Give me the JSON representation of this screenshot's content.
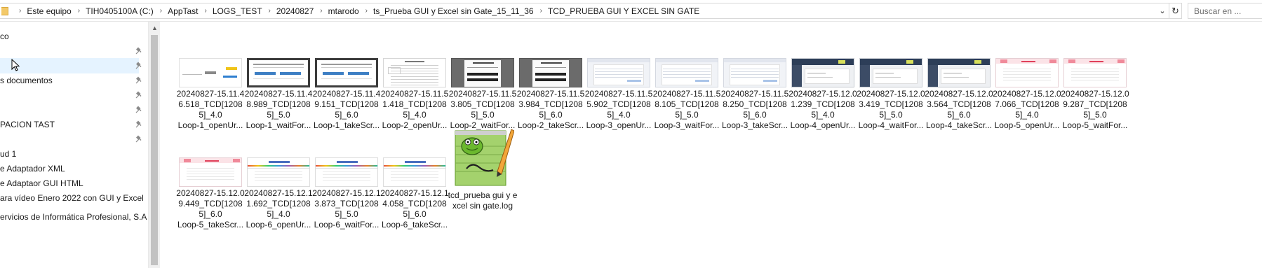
{
  "breadcrumb": [
    "Este equipo",
    "TIH0405100A (C:)",
    "AppTast",
    "LOGS_TEST",
    "20240827",
    "mtarodo",
    "ts_Prueba GUI y Excel sin Gate_15_11_36",
    "TCD_PRUEBA GUI Y EXCEL SIN GATE"
  ],
  "search": {
    "placeholder": "Buscar en ..."
  },
  "nav": {
    "items": [
      {
        "label": "co",
        "pinned": false,
        "selected": false
      },
      {
        "label": "",
        "pinned": true,
        "selected": false
      },
      {
        "label": "",
        "pinned": true,
        "selected": true
      },
      {
        "label": "s documentos",
        "pinned": true,
        "selected": false
      },
      {
        "label": "",
        "pinned": true,
        "selected": false
      },
      {
        "label": "",
        "pinned": true,
        "selected": false
      },
      {
        "label": "PACION TAST",
        "pinned": true,
        "selected": false
      },
      {
        "label": "",
        "pinned": true,
        "selected": false
      },
      {
        "label": "ud 1",
        "pinned": false,
        "selected": false
      },
      {
        "label": "e Adaptador XML",
        "pinned": false,
        "selected": false
      },
      {
        "label": "e Adaptaor GUI HTML",
        "pinned": false,
        "selected": false
      },
      {
        "label": "ara vídeo Enero 2022 con GUI y Excel",
        "pinned": false,
        "selected": false
      },
      {
        "label": "ervicios de Informática Profesional, S.A",
        "pinned": false,
        "selected": false
      }
    ]
  },
  "files": [
    {
      "label": "20240827-15.11.46.518_TCD[12085]_4.0\nLoop-1_openUr...",
      "thumb": "white"
    },
    {
      "label": "20240827-15.11.48.989_TCD[12085]_5.0\nLoop-1_waitFor...",
      "thumb": "dark"
    },
    {
      "label": "20240827-15.11.49.151_TCD[12085]_6.0\nLoop-1_takeScr...",
      "thumb": "dark"
    },
    {
      "label": "20240827-15.11.51.418_TCD[12085]_4.0\nLoop-2_openUr...",
      "thumb": "doc"
    },
    {
      "label": "20240827-15.11.53.805_TCD[12085]_5.0\nLoop-2_waitFor...",
      "thumb": "greydlg"
    },
    {
      "label": "20240827-15.11.53.984_TCD[12085]_6.0\nLoop-2_takeScr...",
      "thumb": "greydlg"
    },
    {
      "label": "20240827-15.11.55.902_TCD[12085]_4.0\nLoop-3_openUr...",
      "thumb": "light"
    },
    {
      "label": "20240827-15.11.58.105_TCD[12085]_5.0\nLoop-3_waitFor...",
      "thumb": "light"
    },
    {
      "label": "20240827-15.11.58.250_TCD[12085]_6.0\nLoop-3_takeScr...",
      "thumb": "light"
    },
    {
      "label": "20240827-15.12.01.239_TCD[12085]_4.0\nLoop-4_openUr...",
      "thumb": "navy"
    },
    {
      "label": "20240827-15.12.03.419_TCD[12085]_5.0\nLoop-4_waitFor...",
      "thumb": "navy"
    },
    {
      "label": "20240827-15.12.03.564_TCD[12085]_6.0\nLoop-4_takeScr...",
      "thumb": "navy"
    },
    {
      "label": "20240827-15.12.07.066_TCD[12085]_4.0\nLoop-5_openUr...",
      "thumb": "pink"
    },
    {
      "label": "20240827-15.12.09.287_TCD[12085]_5.0\nLoop-5_waitFor...",
      "thumb": "pink"
    },
    {
      "label": "20240827-15.12.09.449_TCD[12085]_6.0\nLoop-5_takeScr...",
      "thumb": "pink"
    },
    {
      "label": "20240827-15.12.11.692_TCD[12085]_4.0\nLoop-6_openUr...",
      "thumb": "colorbar"
    },
    {
      "label": "20240827-15.12.13.873_TCD[12085]_5.0\nLoop-6_waitFor...",
      "thumb": "colorbar"
    },
    {
      "label": "20240827-15.12.14.058_TCD[12085]_6.0\nLoop-6_takeScr...",
      "thumb": "colorbar"
    },
    {
      "label": "tcd_prueba gui y excel sin gate.log",
      "thumb": "notepad"
    }
  ],
  "colors": {
    "selection": "#e5f3ff",
    "folder": "#f3c969",
    "notepad_green": "#6bb82e"
  },
  "icons": {
    "refresh": "refresh-icon",
    "dropdown": "chevron-down-icon",
    "pin": "pin-icon",
    "folder": "folder-icon",
    "log": "notepad-plus-plus-icon"
  }
}
